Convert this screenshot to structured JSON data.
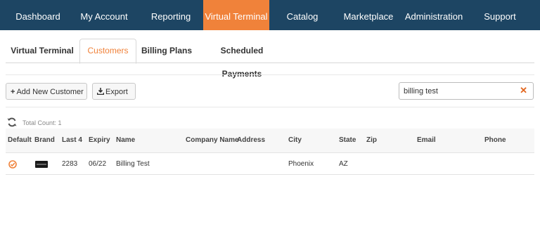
{
  "nav": {
    "items": [
      {
        "label": "Dashboard"
      },
      {
        "label": "My Account"
      },
      {
        "label": "Reporting"
      },
      {
        "label": "Virtual Terminal",
        "active": true
      },
      {
        "label": "Catalog"
      },
      {
        "label": "Marketplace"
      },
      {
        "label": "Administration"
      },
      {
        "label": "Support"
      }
    ]
  },
  "subtabs": [
    {
      "label": "Virtual Terminal"
    },
    {
      "label": "Customers",
      "active": true
    },
    {
      "label": "Billing Plans"
    },
    {
      "label": "Scheduled Payments"
    }
  ],
  "toolbar": {
    "add_label": "Add New Customer",
    "export_label": "Export",
    "search_value": "billing test",
    "clear_icon": "close-icon"
  },
  "list": {
    "total_count": "Total Count: 1",
    "columns": [
      "Default",
      "Brand",
      "Last 4",
      "Expiry",
      "Name",
      "Company Name",
      "Address",
      "City",
      "State",
      "Zip",
      "Email",
      "Phone"
    ],
    "rows": [
      {
        "default": true,
        "brand": "card-icon",
        "last4": "2283",
        "expiry": "06/22",
        "name": "Billing Test",
        "company": "",
        "address": "",
        "city": "Phoenix",
        "state": "AZ",
        "zip": "",
        "email": "",
        "phone": ""
      }
    ]
  },
  "colors": {
    "nav_bg": "#1d4563",
    "accent": "#f0823a"
  }
}
